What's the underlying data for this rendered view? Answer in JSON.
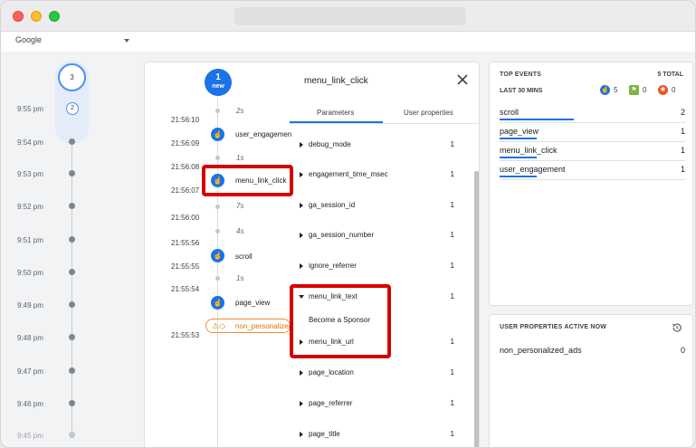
{
  "device": {
    "selected": "Google"
  },
  "minutes": {
    "latest_count": "3",
    "current_count": "2",
    "labels": [
      "9:55 pm",
      "9:54 pm",
      "9:53 pm",
      "9:52 pm",
      "9:51 pm",
      "9:50 pm",
      "9:49 pm",
      "9:48 pm",
      "9:47 pm",
      "9:46 pm",
      "9:45 pm"
    ]
  },
  "seconds": {
    "new_count": "1",
    "new_label": "new",
    "times": [
      "21:56:10",
      "21:56:09",
      "21:56:08",
      "21:56:07",
      "21:56:00",
      "21:55:56",
      "21:55:55",
      "21:55:54",
      "21:55:53"
    ],
    "gaps": [
      "2s",
      "1s",
      "7s",
      "4s",
      "1s"
    ],
    "events": [
      "user_engagement",
      "menu_link_click",
      "scroll",
      "page_view",
      "non_personalized_ads"
    ]
  },
  "parameters": {
    "title": "menu_link_click",
    "tabs": [
      "Parameters",
      "User properties"
    ],
    "rows": [
      {
        "name": "debug_mode",
        "value": "1"
      },
      {
        "name": "engagement_time_msec",
        "value": "1"
      },
      {
        "name": "ga_session_id",
        "value": "1"
      },
      {
        "name": "ga_session_number",
        "value": "1"
      },
      {
        "name": "ignore_referrer",
        "value": "1"
      },
      {
        "name": "menu_link_text",
        "value": "1",
        "expanded_value": "Become a Sponsor"
      },
      {
        "name": "menu_link_url",
        "value": "1"
      },
      {
        "name": "page_location",
        "value": "1"
      },
      {
        "name": "page_referrer",
        "value": "1"
      },
      {
        "name": "page_title",
        "value": "1"
      }
    ]
  },
  "top_events": {
    "title": "TOP EVENTS",
    "total": "5 TOTAL",
    "subtitle": "LAST 30 MINS",
    "stats": [
      "5",
      "0",
      "0"
    ],
    "rows": [
      {
        "name": "scroll",
        "count": "2",
        "share": 0.4
      },
      {
        "name": "page_view",
        "count": "1",
        "share": 0.2
      },
      {
        "name": "menu_link_click",
        "count": "1",
        "share": 0.2
      },
      {
        "name": "user_engagement",
        "count": "1",
        "share": 0.2
      }
    ]
  },
  "user_properties": {
    "title": "USER PROPERTIES ACTIVE NOW",
    "rows": [
      {
        "name": "non_personalized_ads",
        "count": "0"
      }
    ]
  },
  "colors": {
    "accent": "#1a73e8",
    "highlight": "#d50000",
    "warning": "#e8710a"
  }
}
